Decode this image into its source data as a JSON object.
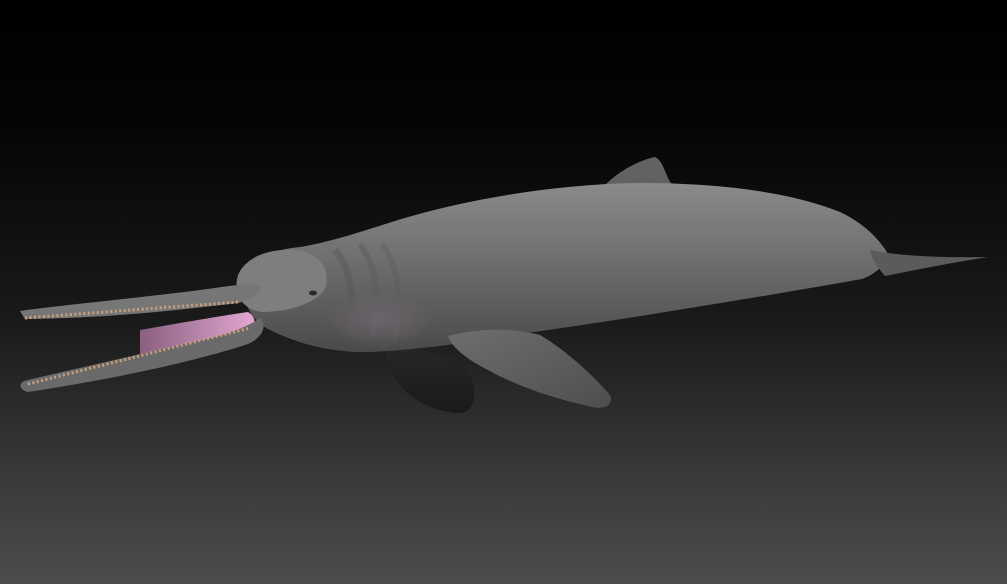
{
  "scene": {
    "subject": "dolphin-3d-model",
    "colors": {
      "background_top": "#000000",
      "background_bottom": "#4c4c4c",
      "body": "#6f6f6f",
      "body_shadow": "#4a4a4a",
      "mouth_interior": "#d79bc8",
      "teeth": "#c9a07c"
    }
  }
}
